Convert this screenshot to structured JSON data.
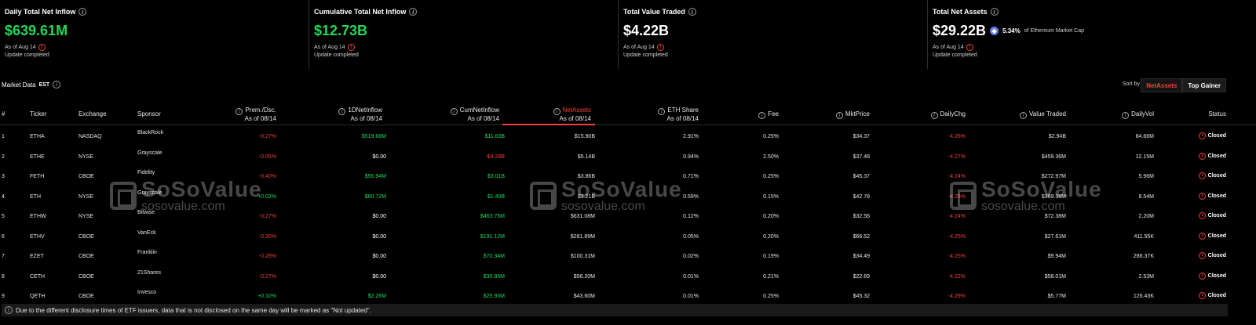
{
  "cards": [
    {
      "title": "Daily Total Net Inflow",
      "value": "$639.61M",
      "color": "#1fd95a",
      "asof": "As of Aug 14",
      "update": "Update completed"
    },
    {
      "title": "Cumulative Total Net Inflow",
      "value": "$12.73B",
      "color": "#1fd95a",
      "asof": "As of Aug 14",
      "update": "Update completed"
    },
    {
      "title": "Total Value Traded",
      "value": "$4.22B",
      "color": "#ffffff",
      "asof": "As of Aug 14",
      "update": "Update completed"
    },
    {
      "title": "Total Net Assets",
      "value": "$29.22B",
      "color": "#ffffff",
      "asof": "As of Aug 14",
      "update": "Update completed",
      "mcap_pct": "5.34%",
      "mcap_text": "of Ethereum Market Cap"
    }
  ],
  "market": {
    "label": "Market Data",
    "tz": "EST",
    "sort_by": "Sort by",
    "sort_active": "NetAssets",
    "sort_other": "Top Gainer"
  },
  "columns": {
    "num": "#",
    "ticker": "Ticker",
    "exchange": "Exchange",
    "sponsor": "Sponsor",
    "prem": "Prem./Dsc.",
    "oneday": "1DNetInflow",
    "cum": "CumNetInflow",
    "netassets": "NetAssets",
    "ethshare": "ETH Share",
    "fee": "Fee",
    "mktprice": "MktPrice",
    "dailychg": "DailyChg",
    "valuetraded": "Value Traded",
    "dailyvol": "DailyVol",
    "status": "Status",
    "asof": "As of 08/14"
  },
  "rows": [
    {
      "num": "1",
      "ticker": "ETHA",
      "exchange": "NASDAQ",
      "sponsor": "BlackRock",
      "prem": "-0.27%",
      "prem_c": "red",
      "oneday": "$519.68M",
      "oneday_c": "green",
      "cum": "$11.83B",
      "cum_c": "green",
      "netassets": "$15.90B",
      "ethshare": "2.91%",
      "fee": "0.25%",
      "mktprice": "$34.37",
      "dailychg": "-4.26%",
      "valuetraded": "$2.94B",
      "dailyvol": "84.66M",
      "status": "Closed"
    },
    {
      "num": "2",
      "ticker": "ETHE",
      "exchange": "NYSE",
      "sponsor": "Grayscale",
      "prem": "-0.05%",
      "prem_c": "red",
      "oneday": "$0.00",
      "oneday_c": "white",
      "cum": "-$4.28B",
      "cum_c": "red",
      "netassets": "$5.14B",
      "ethshare": "0.94%",
      "fee": "2.50%",
      "mktprice": "$37.48",
      "dailychg": "-4.27%",
      "valuetraded": "$459.36M",
      "dailyvol": "12.15M",
      "status": "Closed"
    },
    {
      "num": "3",
      "ticker": "FETH",
      "exchange": "CBOE",
      "sponsor": "Fidelity",
      "prem": "-0.40%",
      "prem_c": "red",
      "oneday": "$56.94M",
      "oneday_c": "green",
      "cum": "$3.01B",
      "cum_c": "green",
      "netassets": "$3.86B",
      "ethshare": "0.71%",
      "fee": "0.25%",
      "mktprice": "$45.37",
      "dailychg": "-4.24%",
      "valuetraded": "$272.97M",
      "dailyvol": "5.96M",
      "status": "Closed"
    },
    {
      "num": "4",
      "ticker": "ETH",
      "exchange": "NYSE",
      "sponsor": "Grayscale",
      "prem": "+0.03%",
      "prem_c": "green",
      "oneday": "$60.72M",
      "oneday_c": "green",
      "cum": "$1.40B",
      "cum_c": "green",
      "netassets": "$3.21B",
      "ethshare": "0.59%",
      "fee": "0.15%",
      "mktprice": "$42.78",
      "dailychg": "-4.25%",
      "valuetraded": "$369.38M",
      "dailyvol": "8.54M",
      "status": "Closed"
    },
    {
      "num": "5",
      "ticker": "ETHW",
      "exchange": "NYSE",
      "sponsor": "Bitwise",
      "prem": "-0.27%",
      "prem_c": "red",
      "oneday": "$0.00",
      "oneday_c": "white",
      "cum": "$463.75M",
      "cum_c": "green",
      "netassets": "$631.08M",
      "ethshare": "0.12%",
      "fee": "0.20%",
      "mktprice": "$32.56",
      "dailychg": "-4.24%",
      "valuetraded": "$72.38M",
      "dailyvol": "2.20M",
      "status": "Closed"
    },
    {
      "num": "6",
      "ticker": "ETHV",
      "exchange": "CBOE",
      "sponsor": "VanEck",
      "prem": "-0.30%",
      "prem_c": "red",
      "oneday": "$0.00",
      "oneday_c": "white",
      "cum": "$191.12M",
      "cum_c": "green",
      "netassets": "$281.89M",
      "ethshare": "0.05%",
      "fee": "0.20%",
      "mktprice": "$66.52",
      "dailychg": "-4.25%",
      "valuetraded": "$27.61M",
      "dailyvol": "411.55K",
      "status": "Closed"
    },
    {
      "num": "7",
      "ticker": "EZET",
      "exchange": "CBOE",
      "sponsor": "Franklin",
      "prem": "-0.28%",
      "prem_c": "red",
      "oneday": "$0.00",
      "oneday_c": "white",
      "cum": "$70.34M",
      "cum_c": "green",
      "netassets": "$100.31M",
      "ethshare": "0.02%",
      "fee": "0.19%",
      "mktprice": "$34.49",
      "dailychg": "-4.25%",
      "valuetraded": "$9.94M",
      "dailyvol": "286.37K",
      "status": "Closed"
    },
    {
      "num": "8",
      "ticker": "CETH",
      "exchange": "CBOE",
      "sponsor": "21Shares",
      "prem": "-0.27%",
      "prem_c": "red",
      "oneday": "$0.00",
      "oneday_c": "white",
      "cum": "$30.83M",
      "cum_c": "green",
      "netassets": "$56.20M",
      "ethshare": "0.01%",
      "fee": "0.21%",
      "mktprice": "$22.69",
      "dailychg": "-4.22%",
      "valuetraded": "$58.01M",
      "dailyvol": "2.53M",
      "status": "Closed"
    },
    {
      "num": "9",
      "ticker": "QETH",
      "exchange": "CBOE",
      "sponsor": "Invesco",
      "prem": "+0.10%",
      "prem_c": "green",
      "oneday": "$2.26M",
      "oneday_c": "green",
      "cum": "$25.93M",
      "cum_c": "green",
      "netassets": "$43.60M",
      "ethshare": "0.01%",
      "fee": "0.25%",
      "mktprice": "$45.32",
      "dailychg": "-4.29%",
      "valuetraded": "$5.77M",
      "dailyvol": "126.43K",
      "status": "Closed"
    }
  ],
  "watermark": {
    "brand": "SoSoValue",
    "url": "sosovalue.com"
  },
  "footer": "Due to the different disclosure times of ETF issuers, data that is not disclosed on the same day will be marked as \"Not updated\"."
}
